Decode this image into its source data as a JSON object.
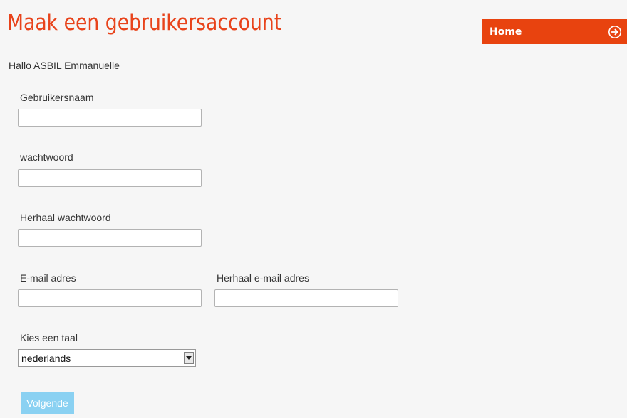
{
  "header": {
    "title": "Maak een gebruikersaccount",
    "home_label": "Home"
  },
  "greeting": "Hallo ASBIL Emmanuelle",
  "form": {
    "username_label": "Gebruikersnaam",
    "password_label": "wachtwoord",
    "repeat_password_label": "Herhaal wachtwoord",
    "email_label": "E-mail adres",
    "repeat_email_label": "Herhaal e-mail adres",
    "language_label": "Kies een taal",
    "language_value": "nederlands",
    "next_label": "Volgende"
  },
  "colors": {
    "accent": "#e8431b",
    "home_bar": "#e8430f",
    "button": "#8ad1f2"
  },
  "icons": {
    "home": "arrow-circle-right-icon",
    "select": "chevron-down-icon"
  }
}
